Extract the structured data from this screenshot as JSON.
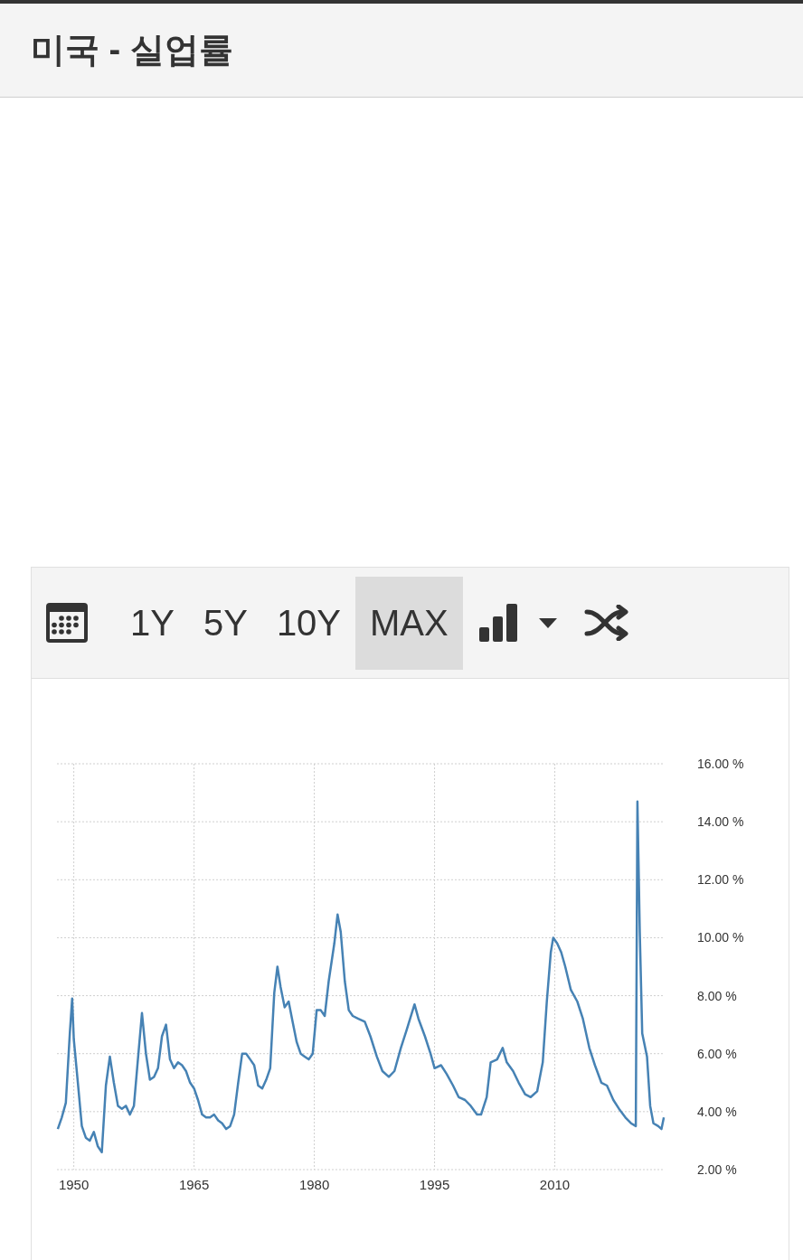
{
  "header": {
    "title": "미국 - 실업률"
  },
  "toolbar": {
    "ranges": [
      {
        "label": "1Y",
        "selected": false
      },
      {
        "label": "5Y",
        "selected": false
      },
      {
        "label": "10Y",
        "selected": false
      },
      {
        "label": "MAX",
        "selected": true
      }
    ]
  },
  "chart": {
    "chart_data": {
      "type": "line",
      "grid": true,
      "xlim": [
        1947.9,
        2023.7
      ],
      "ylim": [
        2,
        16
      ],
      "xticks": [
        {
          "value": 1950,
          "label": "1950"
        },
        {
          "value": 1965,
          "label": "1965"
        },
        {
          "value": 1980,
          "label": "1980"
        },
        {
          "value": 1995,
          "label": "1995"
        },
        {
          "value": 2010,
          "label": "2010"
        }
      ],
      "yticks": [
        {
          "value": 2,
          "label": "2.00 %"
        },
        {
          "value": 4,
          "label": "4.00 %"
        },
        {
          "value": 6,
          "label": "6.00 %"
        },
        {
          "value": 8,
          "label": "8.00 %"
        },
        {
          "value": 10,
          "label": "10.00 %"
        },
        {
          "value": 12,
          "label": "12.00 %"
        },
        {
          "value": 14,
          "label": "14.00 %"
        },
        {
          "value": 16,
          "label": "16.00 %"
        }
      ],
      "x": [
        1948.0,
        1948.5,
        1949.0,
        1949.5,
        1949.8,
        1950.0,
        1950.5,
        1951.0,
        1951.5,
        1952.0,
        1952.5,
        1953.0,
        1953.5,
        1954.0,
        1954.5,
        1955.0,
        1955.5,
        1956.0,
        1956.5,
        1957.0,
        1957.5,
        1958.0,
        1958.5,
        1959.0,
        1959.5,
        1960.0,
        1960.5,
        1961.0,
        1961.5,
        1962.0,
        1962.5,
        1963.0,
        1963.5,
        1964.0,
        1964.5,
        1965.0,
        1965.5,
        1966.0,
        1966.5,
        1967.0,
        1967.5,
        1968.0,
        1968.5,
        1969.0,
        1969.5,
        1970.0,
        1970.5,
        1971.0,
        1971.5,
        1972.0,
        1972.5,
        1973.0,
        1973.5,
        1974.0,
        1974.5,
        1975.0,
        1975.4,
        1975.8,
        1976.3,
        1976.8,
        1977.3,
        1977.8,
        1978.3,
        1978.8,
        1979.3,
        1979.8,
        1980.3,
        1980.8,
        1981.3,
        1981.8,
        1982.5,
        1982.9,
        1983.3,
        1983.8,
        1984.3,
        1984.8,
        1985.5,
        1986.3,
        1987.0,
        1987.8,
        1988.5,
        1989.3,
        1990.0,
        1990.8,
        1991.5,
        1992.5,
        1993.0,
        1993.8,
        1994.5,
        1995.0,
        1995.8,
        1996.5,
        1997.3,
        1998.0,
        1998.8,
        1999.5,
        2000.3,
        2000.8,
        2001.5,
        2002.0,
        2002.8,
        2003.5,
        2004.0,
        2004.8,
        2005.5,
        2006.3,
        2007.0,
        2007.8,
        2008.5,
        2009.0,
        2009.5,
        2009.8,
        2010.3,
        2010.8,
        2011.3,
        2012.0,
        2012.8,
        2013.5,
        2014.3,
        2015.0,
        2015.8,
        2016.5,
        2017.3,
        2018.0,
        2018.8,
        2019.5,
        2020.1,
        2020.3,
        2020.6,
        2020.9,
        2021.5,
        2021.9,
        2022.3,
        2022.9,
        2023.3,
        2023.6
      ],
      "series": [
        {
          "color": "#4682b4",
          "values": [
            3.4,
            3.8,
            4.3,
            6.7,
            7.9,
            6.5,
            5.0,
            3.5,
            3.1,
            3.0,
            3.3,
            2.8,
            2.6,
            4.9,
            5.9,
            5.0,
            4.2,
            4.1,
            4.2,
            3.9,
            4.2,
            5.8,
            7.4,
            6.0,
            5.1,
            5.2,
            5.5,
            6.6,
            7.0,
            5.8,
            5.5,
            5.7,
            5.6,
            5.4,
            5.0,
            4.8,
            4.4,
            3.9,
            3.8,
            3.8,
            3.9,
            3.7,
            3.6,
            3.4,
            3.5,
            3.9,
            5.0,
            6.0,
            6.0,
            5.8,
            5.6,
            4.9,
            4.8,
            5.1,
            5.5,
            8.1,
            9.0,
            8.3,
            7.6,
            7.8,
            7.1,
            6.4,
            6.0,
            5.9,
            5.8,
            6.0,
            7.5,
            7.5,
            7.3,
            8.5,
            9.8,
            10.8,
            10.2,
            8.5,
            7.5,
            7.3,
            7.2,
            7.1,
            6.6,
            5.9,
            5.4,
            5.2,
            5.4,
            6.2,
            6.8,
            7.7,
            7.2,
            6.6,
            6.0,
            5.5,
            5.6,
            5.3,
            4.9,
            4.5,
            4.4,
            4.2,
            3.9,
            3.9,
            4.5,
            5.7,
            5.8,
            6.2,
            5.7,
            5.4,
            5.0,
            4.6,
            4.5,
            4.7,
            5.7,
            7.8,
            9.5,
            10.0,
            9.8,
            9.5,
            9.0,
            8.2,
            7.8,
            7.2,
            6.2,
            5.6,
            5.0,
            4.9,
            4.4,
            4.1,
            3.8,
            3.6,
            3.5,
            14.7,
            10.2,
            6.7,
            5.9,
            4.2,
            3.6,
            3.5,
            3.4,
            3.8
          ]
        }
      ]
    }
  }
}
